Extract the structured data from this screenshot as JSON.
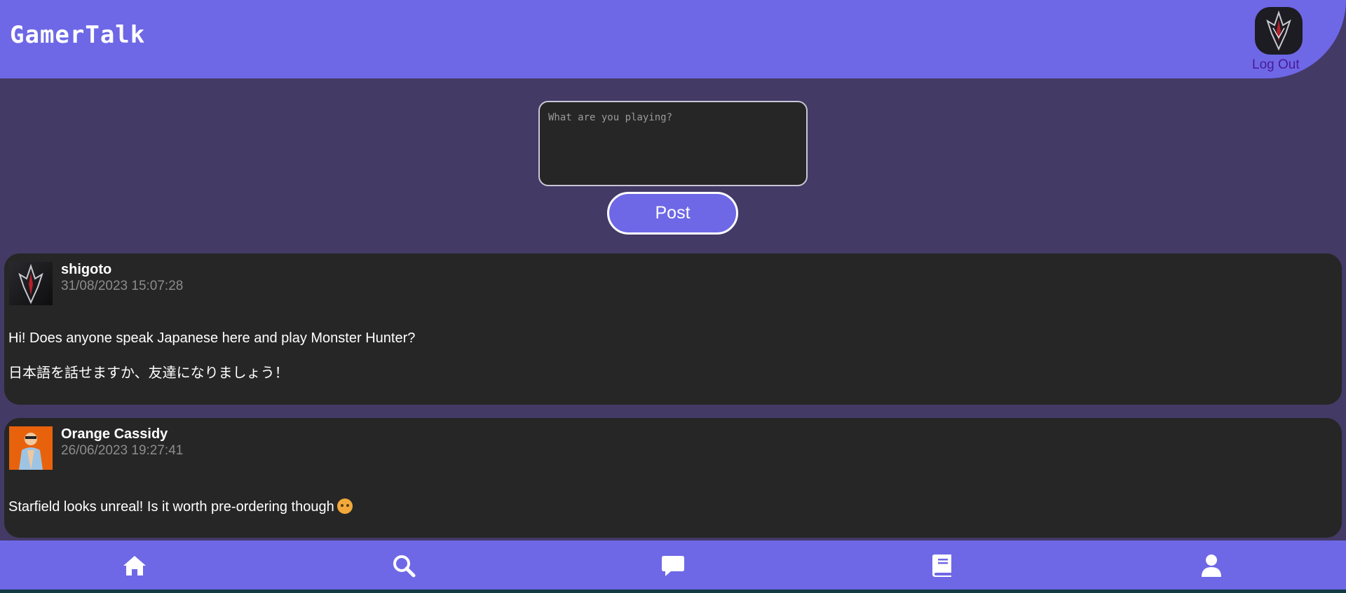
{
  "app": {
    "title": "GamerTalk",
    "logout_label": "Log Out",
    "accent_color": "#6e68e6",
    "background_color": "#443a66"
  },
  "composer": {
    "placeholder": "What are you playing?",
    "value": "",
    "post_label": "Post"
  },
  "posts": [
    {
      "username": "shigoto",
      "timestamp": "31/08/2023 15:07:28",
      "avatar_icon": "shigoto-avatar",
      "lines": [
        "Hi! Does anyone speak Japanese here and play Monster Hunter?",
        "日本語を話せますか、友達になりましょう！"
      ]
    },
    {
      "username": "Orange Cassidy",
      "timestamp": "26/06/2023 19:27:41",
      "avatar_icon": "orange-cassidy-avatar",
      "lines": [
        "Starfield looks unreal! Is it worth pre-ordering though"
      ],
      "emoji": "thinking-face-emoji"
    }
  ],
  "nav": [
    {
      "name": "home",
      "icon": "home-icon"
    },
    {
      "name": "search",
      "icon": "search-icon"
    },
    {
      "name": "messages",
      "icon": "chat-bubble-icon"
    },
    {
      "name": "library",
      "icon": "book-icon"
    },
    {
      "name": "profile",
      "icon": "user-icon"
    }
  ]
}
